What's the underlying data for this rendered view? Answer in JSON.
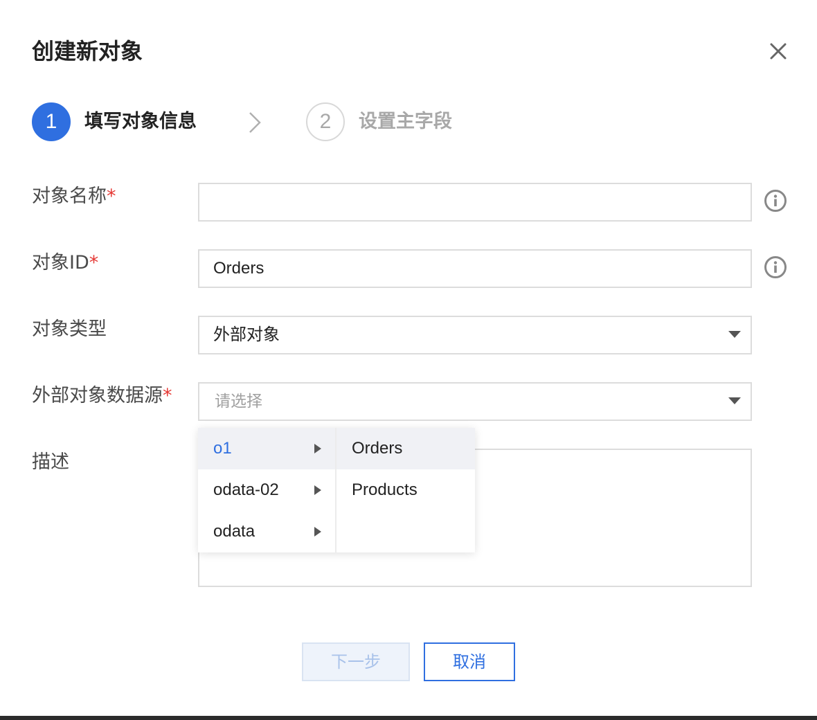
{
  "dialog": {
    "title": "创建新对象",
    "close_icon": "close-icon"
  },
  "steps": [
    {
      "number": "1",
      "label": "填写对象信息",
      "state": "active"
    },
    {
      "number": "2",
      "label": "设置主字段",
      "state": "inactive"
    }
  ],
  "form": {
    "object_name": {
      "label": "对象名称",
      "required_mark": "*",
      "value": "",
      "info_icon": "info-icon"
    },
    "object_id": {
      "label": "对象ID",
      "required_mark": "*",
      "value": "Orders",
      "info_icon": "info-icon"
    },
    "object_type": {
      "label": "对象类型",
      "value": "外部对象"
    },
    "external_source": {
      "label": "外部对象数据源",
      "required_mark": "*",
      "placeholder": "请选择"
    },
    "description": {
      "label": "描述",
      "value": ""
    }
  },
  "cascader": {
    "level1": [
      {
        "label": "o1",
        "active": true
      },
      {
        "label": "odata-02",
        "active": false
      },
      {
        "label": "odata",
        "active": false
      }
    ],
    "level2": [
      {
        "label": "Orders",
        "active": true
      },
      {
        "label": "Products",
        "active": false
      }
    ]
  },
  "buttons": {
    "next": "下一步",
    "cancel": "取消"
  },
  "colors": {
    "primary": "#2f6fe0",
    "required": "#e53935",
    "border": "#dcdcdc",
    "disabled_text": "#a9c2ea"
  }
}
